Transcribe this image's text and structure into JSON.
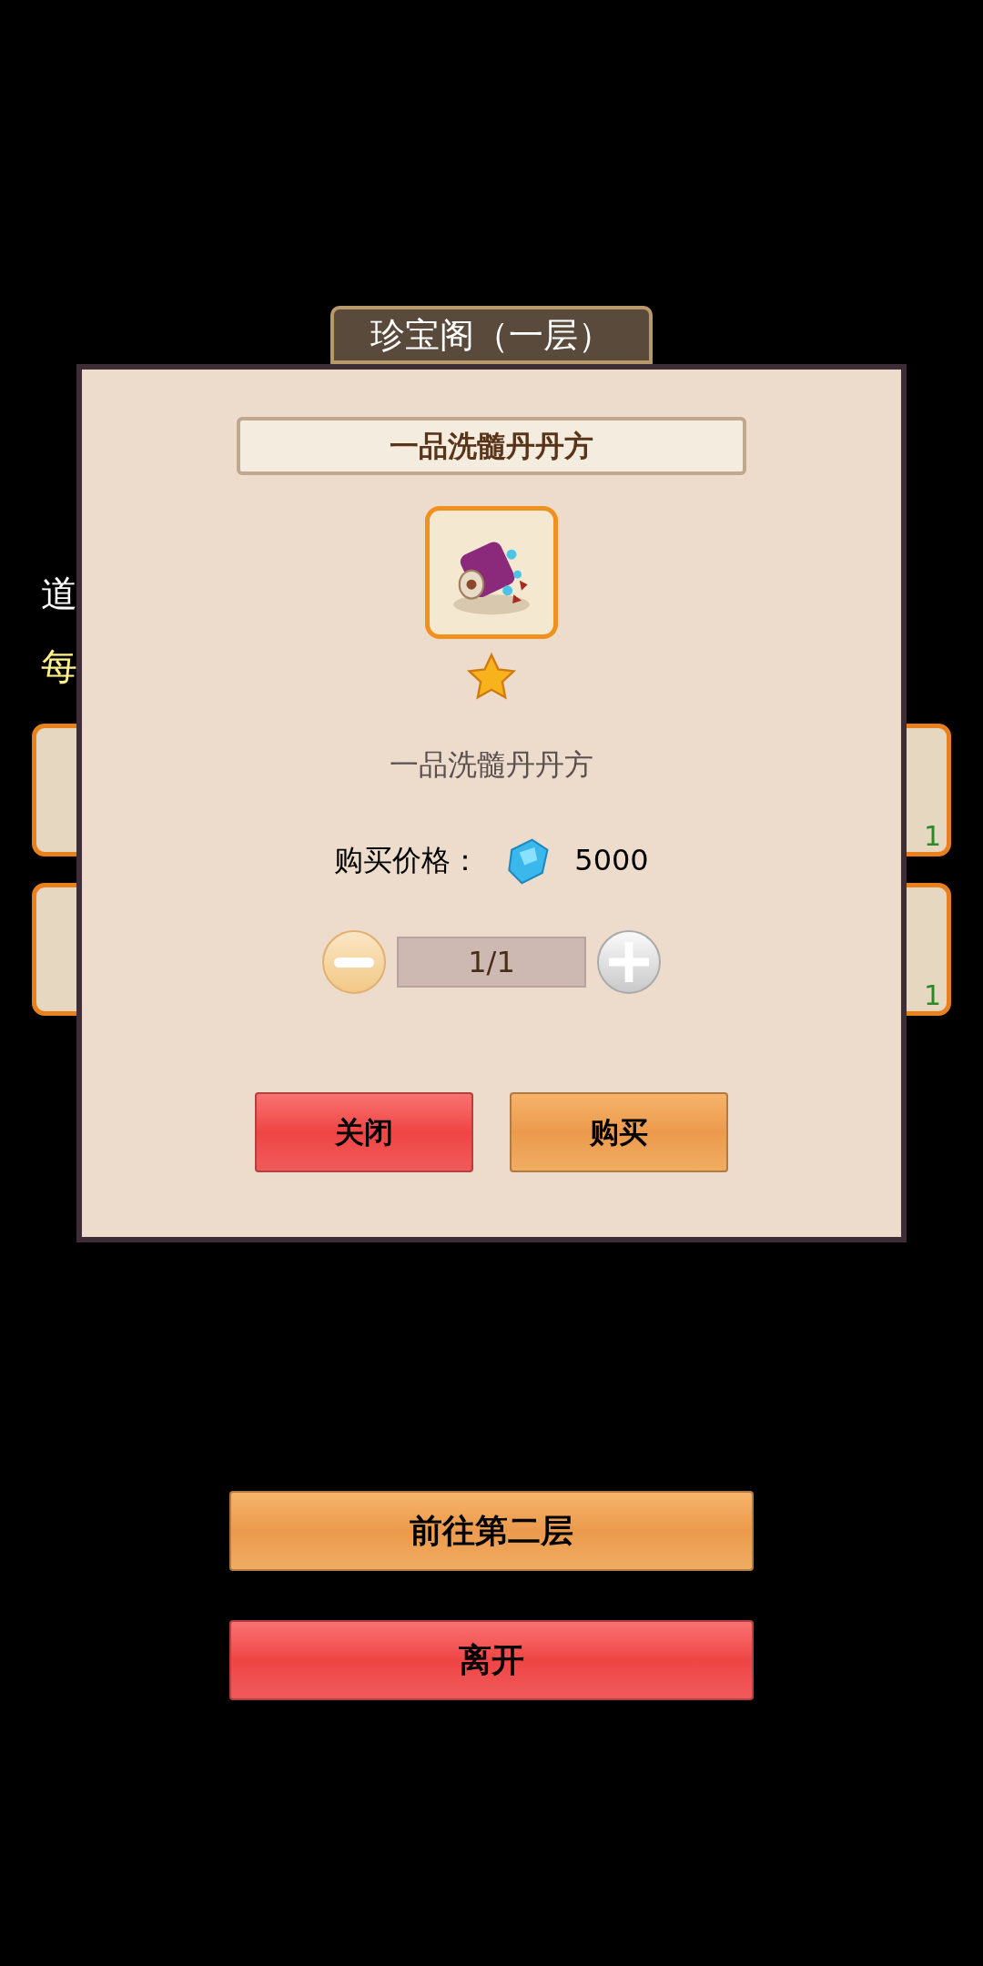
{
  "header": {
    "title": "珍宝阁（一层）"
  },
  "background": {
    "prompt": "道",
    "notice": "每",
    "item_rows": [
      {
        "count": "1"
      },
      {
        "count": "1"
      }
    ]
  },
  "dialog": {
    "title": "一品洗髓丹丹方",
    "item_name": "一品洗髓丹丹方",
    "price_label": "购买价格：",
    "price": "5000",
    "quantity": "1/1",
    "buttons": [
      {
        "label": "关闭",
        "kind": "red"
      },
      {
        "label": "购买",
        "kind": "orange"
      }
    ]
  },
  "bottom_buttons": [
    {
      "label": "前往第二层",
      "kind": "orange"
    },
    {
      "label": "离开",
      "kind": "red"
    }
  ]
}
